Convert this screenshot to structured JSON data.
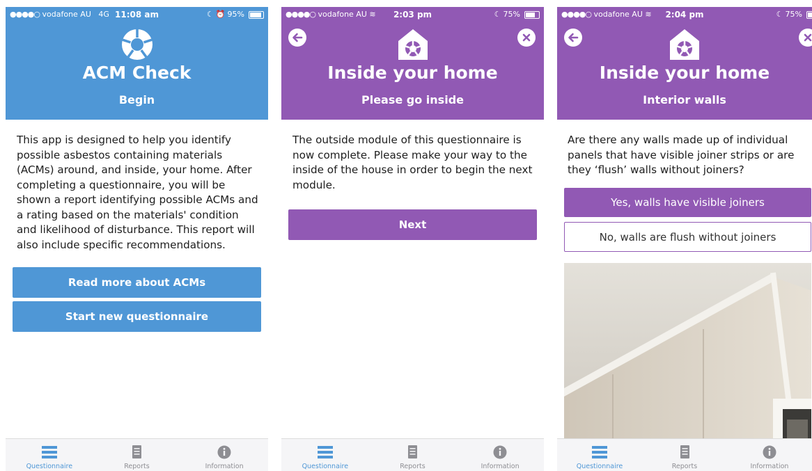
{
  "colors": {
    "blue": "#4f97d6",
    "purple": "#9159b4",
    "tab_inactive": "#8e8e93"
  },
  "screens": [
    {
      "status": {
        "carrier": "vodafone AU",
        "network": "4G",
        "time": "11:08 am",
        "battery": "95%",
        "battery_level": 0.95
      },
      "header": {
        "title": "ACM Check",
        "subtitle": "Begin",
        "logo_icon": "acm-logo-icon"
      },
      "body_text": "This app is designed to help you identify possible asbestos containing materials (ACMs) around, and inside, your home. After completing a questionnaire, you will be shown a report identifying possible ACMs and a rating based on the materials' condition and likelihood of disturbance. This report will also include specific recommendations.",
      "buttons": {
        "read_more": "Read more about ACMs",
        "start_new": "Start new questionnaire"
      },
      "tabs": [
        "Questionnaire",
        "Reports",
        "Information"
      ]
    },
    {
      "status": {
        "carrier": "vodafone AU",
        "time": "2:03 pm",
        "battery": "75%",
        "battery_level": 0.75
      },
      "header": {
        "title": "Inside your home",
        "subtitle": "Please go inside",
        "logo_icon": "house-logo-icon"
      },
      "body_text": "The outside module of this questionnaire is now complete. Please make your way to the inside of the house in order to begin the next module.",
      "buttons": {
        "next": "Next"
      },
      "tabs": [
        "Questionnaire",
        "Reports",
        "Information"
      ]
    },
    {
      "status": {
        "carrier": "vodafone AU",
        "time": "2:04 pm",
        "battery": "75%",
        "battery_level": 0.75
      },
      "header": {
        "title": "Inside your home",
        "subtitle": "Interior walls",
        "logo_icon": "house-logo-icon"
      },
      "body_text": "Are there any walls made up of individual panels that have visible joiner strips or are they ‘flush’ walls without joiners?",
      "options": {
        "yes": "Yes, walls have visible joiners",
        "no": "No, walls are flush without joiners"
      },
      "tabs": [
        "Questionnaire",
        "Reports",
        "Information"
      ]
    }
  ]
}
